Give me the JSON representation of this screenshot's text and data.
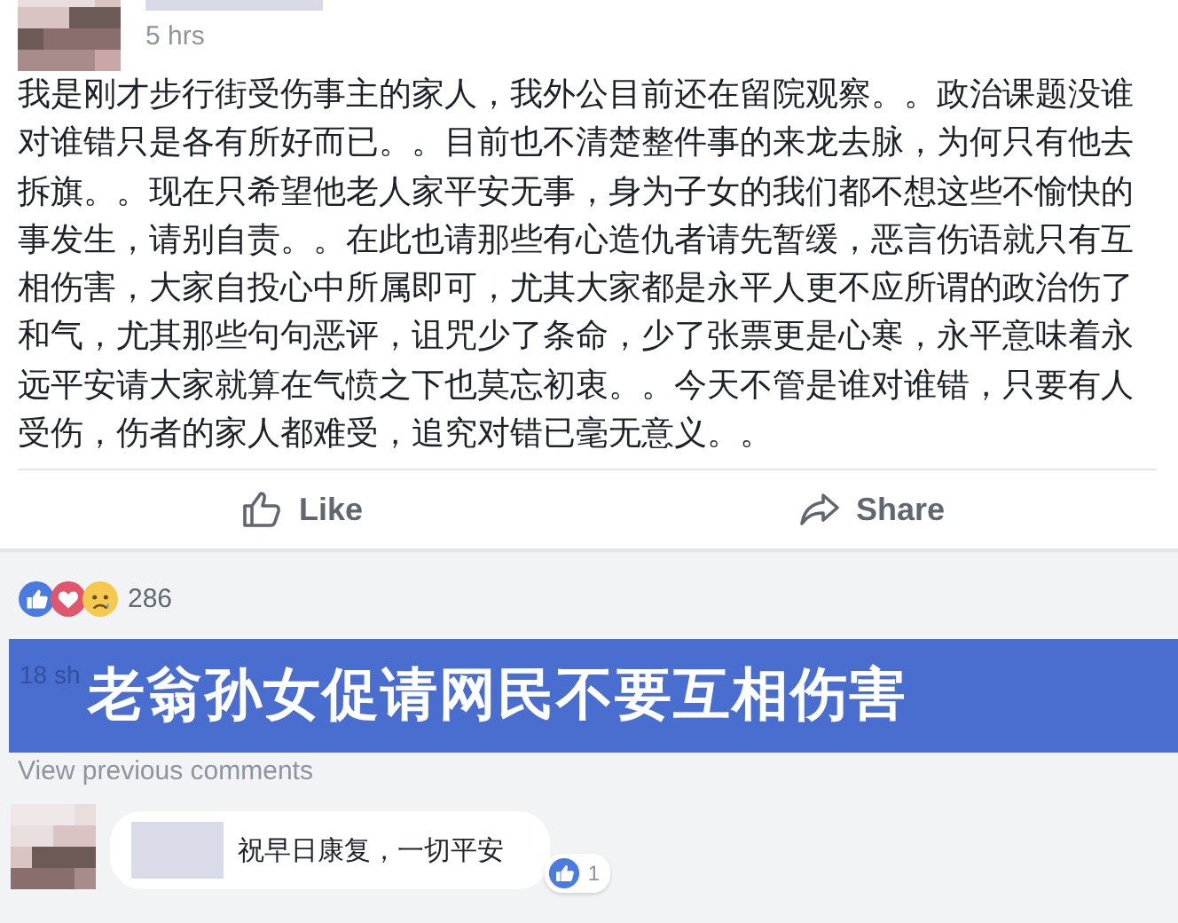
{
  "post": {
    "time": "5 hrs",
    "body": "我是刚才步行街受伤事主的家人，我外公目前还在留院观察。。政治课题没谁对谁错只是各有所好而已。。目前也不清楚整件事的来龙去脉，为何只有他去拆旗。。现在只希望他老人家平安无事，身为子女的我们都不想这些不愉快的事发生，请别自责。。在此也请那些有心造仇者请先暂缓，恶言伤语就只有互相伤害，大家自投心中所属即可，尤其大家都是永平人更不应所谓的政治伤了和气，尤其那些句句恶评，诅咒少了条命，少了张票更是心寒，永平意味着永远平安请大家就算在气愤之下也莫忘初衷。。今天不管是谁对谁错，只要有人受伤，伤者的家人都难受，追究对错已毫无意义。。"
  },
  "actions": [
    {
      "kind": "like",
      "label": "Like"
    },
    {
      "kind": "share",
      "label": "Share"
    }
  ],
  "reactions": {
    "count": "286"
  },
  "shares": "18 sh",
  "banner": "老翁孙女促请网民不要互相伤害",
  "view_previous": "View previous comments",
  "comments": [
    {
      "text": "祝早日康复，一切平安",
      "likes": "1"
    }
  ]
}
